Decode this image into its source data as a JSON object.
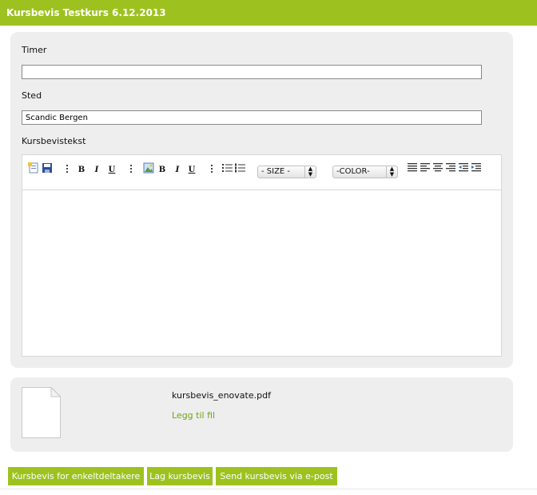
{
  "header": {
    "title": "Kursbevis Testkurs 6.12.2013"
  },
  "form": {
    "timer_label": "Timer",
    "timer_value": "",
    "sted_label": "Sted",
    "sted_value": "Scandic Bergen",
    "text_label": "Kursbevistekst"
  },
  "editor": {
    "toolbar": {
      "bold": "B",
      "italic": "I",
      "underline": "U",
      "size_select": "- SIZE -",
      "color_select": "-COLOR-"
    },
    "content": ""
  },
  "file": {
    "name": "kursbevis_enovate.pdf",
    "add_link": "Legg til fil"
  },
  "actions": {
    "single_participant": "Kursbevis for enkeltdeltakere",
    "create": "Lag kursbevis",
    "send_email": "Send kursbevis via e-post"
  },
  "colors": {
    "accent": "#9dc21f",
    "link": "#6ea511",
    "panel": "#eeeeee"
  },
  "icons": [
    "new-document-icon",
    "save-icon",
    "insert-image-icon",
    "bullet-list-icon",
    "numbered-list-icon",
    "align-left-icon",
    "align-center-icon",
    "align-right-icon",
    "justify-icon",
    "outdent-icon",
    "indent-icon",
    "file-icon"
  ]
}
